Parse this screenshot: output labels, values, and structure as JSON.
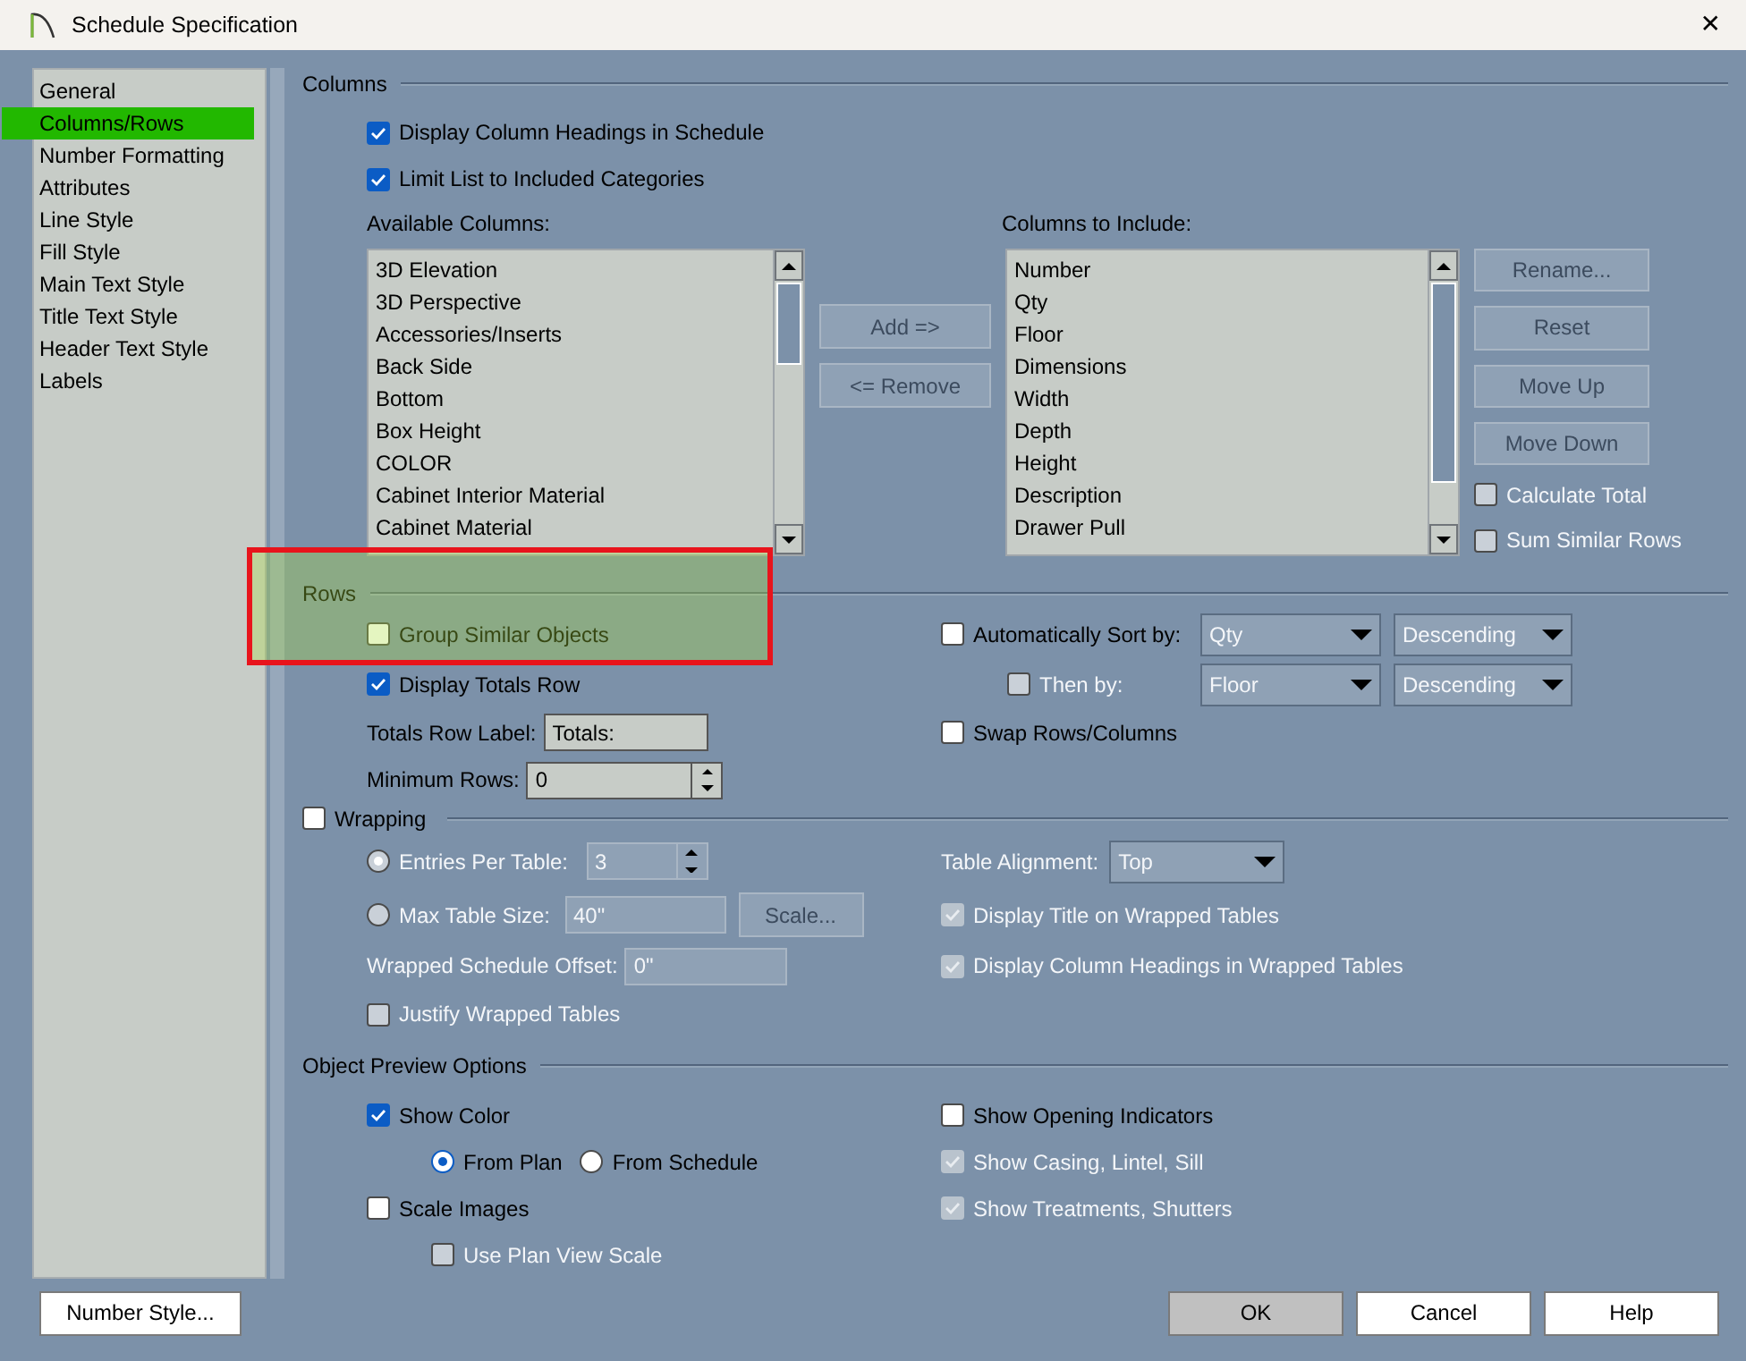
{
  "window": {
    "title": "Schedule Specification",
    "close": "✕"
  },
  "sidebar": {
    "items": [
      {
        "label": "General",
        "selected": false
      },
      {
        "label": "Columns/Rows",
        "selected": true
      },
      {
        "label": "Number Formatting",
        "selected": false
      },
      {
        "label": "Attributes",
        "selected": false
      },
      {
        "label": "Line Style",
        "selected": false
      },
      {
        "label": "Fill Style",
        "selected": false
      },
      {
        "label": "Main Text Style",
        "selected": false
      },
      {
        "label": "Title Text Style",
        "selected": false
      },
      {
        "label": "Header Text Style",
        "selected": false
      },
      {
        "label": "Labels",
        "selected": false
      }
    ]
  },
  "columns_section": {
    "title": "Columns",
    "options": [
      {
        "label": "Display Column Headings in Schedule",
        "checked": true
      },
      {
        "label": "Limit List to Included Categories",
        "checked": true
      }
    ],
    "available": {
      "label": "Available Columns:",
      "items": [
        "3D Elevation",
        "3D Perspective",
        "Accessories/Inserts",
        "Back Side",
        "Bottom",
        "Box Height",
        "COLOR",
        "Cabinet Interior Material",
        "Cabinet Material"
      ]
    },
    "transfer_buttons": [
      {
        "label": "Add =>",
        "disabled": true
      },
      {
        "label": "<= Remove",
        "disabled": true
      }
    ],
    "included": {
      "label": "Columns to Include:",
      "items": [
        "Number",
        "Qty",
        "Floor",
        "Dimensions",
        "Width",
        "Depth",
        "Height",
        "Description",
        "Drawer Pull"
      ]
    },
    "side_buttons": [
      {
        "label": "Rename...",
        "disabled": true
      },
      {
        "label": "Reset",
        "disabled": true
      },
      {
        "label": "Move Up",
        "disabled": true
      },
      {
        "label": "Move Down",
        "disabled": true
      }
    ],
    "side_options": [
      {
        "label": "Calculate Total",
        "checked": false,
        "disabled": true
      },
      {
        "label": "Sum Similar Rows",
        "checked": false,
        "disabled": true
      }
    ]
  },
  "rows_section": {
    "title": "Rows",
    "group_similar": {
      "label": "Group Similar Objects",
      "checked": false
    },
    "display_totals": {
      "label": "Display Totals Row",
      "checked": true
    },
    "totals_label": {
      "label": "Totals Row Label:",
      "value": "Totals:"
    },
    "minimum_rows": {
      "label": "Minimum Rows:",
      "value": "0"
    },
    "auto_sort": {
      "label": "Automatically Sort by:",
      "checked": false,
      "field": "Qty",
      "order": "Descending"
    },
    "then_by": {
      "label": "Then by:",
      "checked": false,
      "field": "Floor",
      "order": "Descending"
    },
    "swap": {
      "label": "Swap Rows/Columns",
      "checked": false
    }
  },
  "wrapping": {
    "label": "Wrapping",
    "checked": false,
    "entries": {
      "label": "Entries Per Table:",
      "value": "3",
      "selected": true
    },
    "max_size": {
      "label": "Max Table Size:",
      "value": "40\"",
      "selected": false
    },
    "scale_button": "Scale...",
    "offset": {
      "label": "Wrapped Schedule Offset:",
      "value": "0\""
    },
    "justify": {
      "label": "Justify Wrapped Tables",
      "checked": false
    },
    "alignment": {
      "label": "Table Alignment:",
      "value": "Top"
    },
    "title_on_wrapped": {
      "label": "Display Title on Wrapped Tables",
      "checked": true
    },
    "headings_on_wrapped": {
      "label": "Display Column Headings in Wrapped Tables",
      "checked": true
    }
  },
  "preview": {
    "title": "Object Preview Options",
    "show_color": {
      "label": "Show Color",
      "checked": true
    },
    "color_source": [
      {
        "label": "From Plan",
        "selected": true
      },
      {
        "label": "From Schedule",
        "selected": false
      }
    ],
    "scale_images": {
      "label": "Scale Images",
      "checked": false
    },
    "plan_view_scale": {
      "label": "Use Plan View Scale",
      "checked": false,
      "disabled": true
    },
    "opening_indicators": {
      "label": "Show Opening Indicators",
      "checked": false
    },
    "casing": {
      "label": "Show Casing, Lintel, Sill",
      "checked": true,
      "disabled": true
    },
    "treatments": {
      "label": "Show Treatments, Shutters",
      "checked": true,
      "disabled": true
    }
  },
  "footer": {
    "left_button": "Number Style...",
    "buttons": [
      {
        "label": "OK",
        "default": true
      },
      {
        "label": "Cancel",
        "default": false
      },
      {
        "label": "Help",
        "default": false
      }
    ]
  }
}
